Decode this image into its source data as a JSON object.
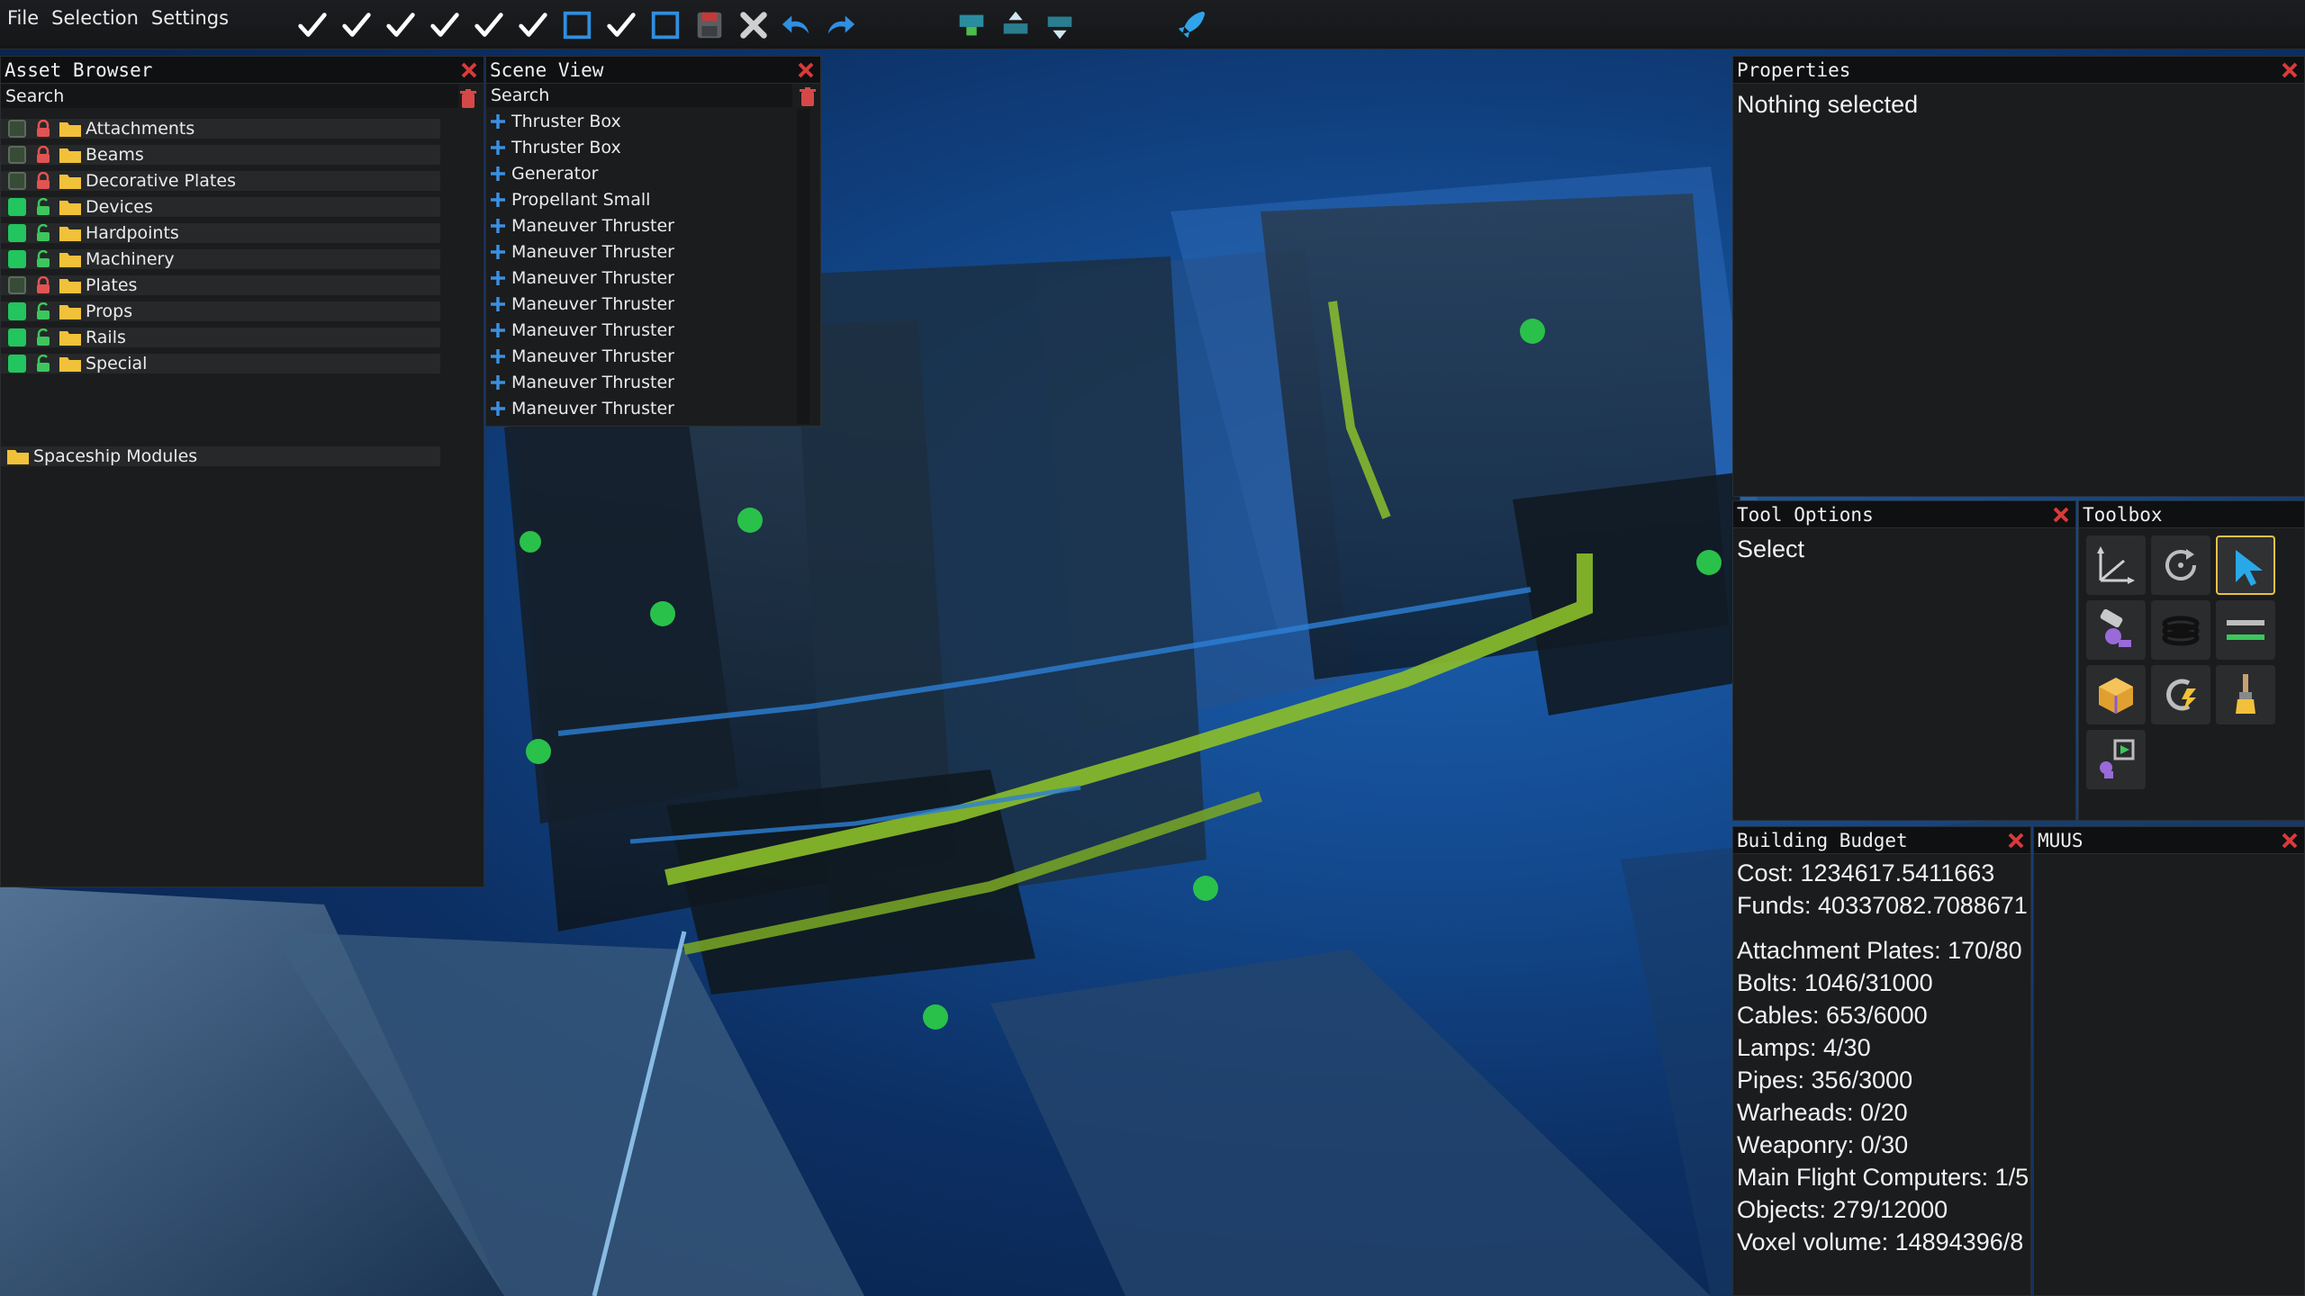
{
  "menu": {
    "items": [
      "File",
      "Selection",
      "Settings"
    ]
  },
  "toolbar": {
    "buttons": [
      {
        "name": "toggle-check-1",
        "icon": "checkmark-icon"
      },
      {
        "name": "toggle-check-2",
        "icon": "checkmark-icon"
      },
      {
        "name": "toggle-check-3",
        "icon": "checkmark-icon"
      },
      {
        "name": "toggle-check-4",
        "icon": "checkmark-icon"
      },
      {
        "name": "toggle-check-5",
        "icon": "checkmark-icon"
      },
      {
        "name": "toggle-check-6",
        "icon": "checkmark-icon"
      },
      {
        "name": "toggle-box-1",
        "icon": "empty-square-icon"
      },
      {
        "name": "toggle-check-7",
        "icon": "checkmark-icon"
      },
      {
        "name": "toggle-box-2",
        "icon": "empty-square-icon"
      },
      {
        "name": "save",
        "icon": "floppy-disk-icon"
      },
      {
        "name": "close",
        "icon": "x-icon"
      },
      {
        "name": "undo",
        "icon": "undo-arrow-icon"
      },
      {
        "name": "redo",
        "icon": "redo-arrow-icon"
      },
      {
        "name": "layer-1",
        "icon": "layer-icon"
      },
      {
        "name": "layer-up",
        "icon": "layer-up-icon"
      },
      {
        "name": "layer-down",
        "icon": "layer-down-icon"
      },
      {
        "name": "launch",
        "icon": "rocket-icon"
      }
    ]
  },
  "asset_browser": {
    "title": "Asset Browser",
    "search_label": "Search",
    "items": [
      {
        "label": "Attachments",
        "checked": false,
        "locked": true
      },
      {
        "label": "Beams",
        "checked": false,
        "locked": true
      },
      {
        "label": "Decorative Plates",
        "checked": false,
        "locked": true
      },
      {
        "label": "Devices",
        "checked": true,
        "locked": false
      },
      {
        "label": "Hardpoints",
        "checked": true,
        "locked": false
      },
      {
        "label": "Machinery",
        "checked": true,
        "locked": false
      },
      {
        "label": "Plates",
        "checked": false,
        "locked": true
      },
      {
        "label": "Props",
        "checked": true,
        "locked": false
      },
      {
        "label": "Rails",
        "checked": true,
        "locked": false
      },
      {
        "label": "Special",
        "checked": true,
        "locked": false
      }
    ],
    "modules_label": "Spaceship Modules"
  },
  "scene_view": {
    "title": "Scene View",
    "search_label": "Search",
    "items": [
      "Thruster Box",
      "Thruster Box",
      "Generator",
      "Propellant Small",
      "Maneuver Thruster",
      "Maneuver Thruster",
      "Maneuver Thruster",
      "Maneuver Thruster",
      "Maneuver Thruster",
      "Maneuver Thruster",
      "Maneuver Thruster",
      "Maneuver Thruster"
    ]
  },
  "properties": {
    "title": "Properties",
    "empty_text": "Nothing selected"
  },
  "tool_options": {
    "title": "Tool Options",
    "current_tool": "Select"
  },
  "toolbox": {
    "title": "Toolbox",
    "tools": [
      {
        "name": "move-tool",
        "icon": "move-axes-icon",
        "selected": false
      },
      {
        "name": "rotate-tool",
        "icon": "rotate-icon",
        "selected": false
      },
      {
        "name": "select-tool",
        "icon": "cursor-arrow-icon",
        "selected": true
      },
      {
        "name": "bolt-tool",
        "icon": "bolt-tool-icon",
        "selected": false
      },
      {
        "name": "cable-tool",
        "icon": "cable-coil-icon",
        "selected": false
      },
      {
        "name": "pipe-tool",
        "icon": "pipe-icon",
        "selected": false
      },
      {
        "name": "voxel-tool",
        "icon": "voxel-cube-icon",
        "selected": false
      },
      {
        "name": "power-tool",
        "icon": "power-connector-icon",
        "selected": false
      },
      {
        "name": "paint-tool",
        "icon": "paint-brush-icon",
        "selected": false
      },
      {
        "name": "logic-tool",
        "icon": "logic-play-icon",
        "selected": false
      }
    ]
  },
  "building_budget": {
    "title": "Building Budget",
    "cost": "Cost: 1234617.5411663",
    "funds": "Funds: 40337082.7088671",
    "lines": [
      "Attachment Plates: 170/80",
      "Bolts: 1046/31000",
      "Cables: 653/6000",
      "Lamps: 4/30",
      "Pipes: 356/3000",
      "Warheads: 0/20",
      "Weaponry: 0/30",
      "Main Flight Computers: 1/5",
      "Objects: 279/12000",
      "Voxel volume: 14894396/8"
    ]
  },
  "muus": {
    "title": "MUUS"
  },
  "colors": {
    "accent_green": "#22c55e",
    "close_red": "#d93a3a",
    "selected_tool_border": "#e3c24a",
    "toolbar_blue": "#2f8fe0"
  }
}
